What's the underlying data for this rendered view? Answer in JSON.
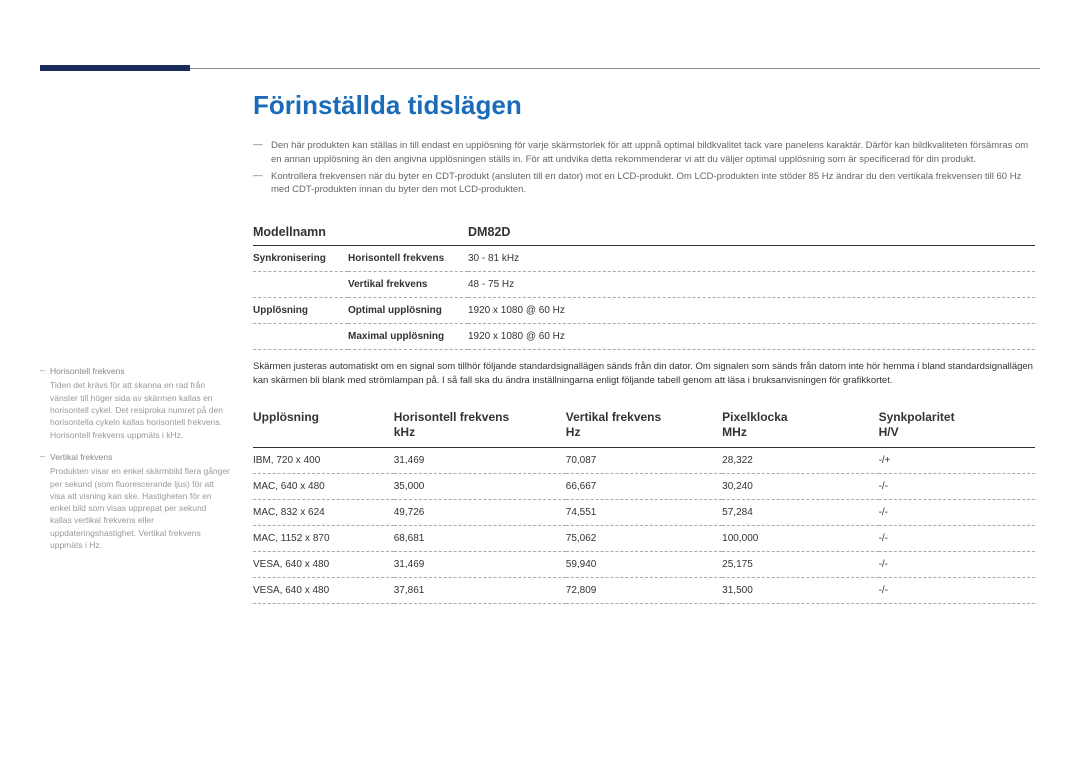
{
  "title": "Förinställda tidslägen",
  "notes": [
    "Den här produkten kan ställas in till endast en upplösning för varje skärmstorlek för att uppnå optimal bildkvalitet tack vare panelens karaktär. Därför kan bildkvaliteten försämras om en annan upplösning än den angivna upplösningen ställs in. För att undvika detta rekommenderar vi att du väljer optimal upplösning som är specificerad för din produkt.",
    "Kontrollera frekvensen när du byter en CDT-produkt (ansluten till en dator) mot en LCD-produkt. Om LCD-produkten inte stöder 85 Hz ändrar du den vertikala frekvensen till 60 Hz med CDT-produkten innan du byter den mot LCD-produkten."
  ],
  "spec": {
    "model_label": "Modellnamn",
    "model_value": "DM82D",
    "rows": [
      {
        "group": "Synkronisering",
        "k": "Horisontell frekvens",
        "v": "30 - 81 kHz"
      },
      {
        "group": "",
        "k": "Vertikal frekvens",
        "v": "48 - 75 Hz"
      },
      {
        "group": "Upplösning",
        "k": "Optimal upplösning",
        "v": "1920 x 1080 @ 60 Hz"
      },
      {
        "group": "",
        "k": "Maximal upplösning",
        "v": "1920 x 1080 @ 60 Hz"
      }
    ]
  },
  "between_text": "Skärmen justeras automatiskt om en signal som tillhör följande standardsignallägen sänds från din dator. Om signalen som sänds från datorn inte hör hemma i bland standardsignallägen kan skärmen bli blank med strömlampan på. I så fall ska du ändra inställningarna enligt följande tabell genom att läsa i bruksanvisningen för grafikkortet.",
  "timing": {
    "headers": {
      "res": {
        "l1": "Upplösning",
        "l2": ""
      },
      "hfreq": {
        "l1": "Horisontell frekvens",
        "l2": "kHz"
      },
      "vfreq": {
        "l1": "Vertikal frekvens",
        "l2": "Hz"
      },
      "pclk": {
        "l1": "Pixelklocka",
        "l2": "MHz"
      },
      "pol": {
        "l1": "Synkpolaritet",
        "l2": "H/V"
      }
    },
    "rows": [
      {
        "res": "IBM, 720 x 400",
        "h": "31,469",
        "v": "70,087",
        "p": "28,322",
        "pol": "-/+"
      },
      {
        "res": "MAC, 640 x 480",
        "h": "35,000",
        "v": "66,667",
        "p": "30,240",
        "pol": "-/-"
      },
      {
        "res": "MAC, 832 x 624",
        "h": "49,726",
        "v": "74,551",
        "p": "57,284",
        "pol": "-/-"
      },
      {
        "res": "MAC, 1152 x 870",
        "h": "68,681",
        "v": "75,062",
        "p": "100,000",
        "pol": "-/-"
      },
      {
        "res": "VESA, 640 x 480",
        "h": "31,469",
        "v": "59,940",
        "p": "25,175",
        "pol": "-/-"
      },
      {
        "res": "VESA, 640 x 480",
        "h": "37,861",
        "v": "72,809",
        "p": "31,500",
        "pol": "-/-"
      }
    ]
  },
  "sidebar": {
    "h": {
      "term": "Horisontell frekvens",
      "def": "Tiden det krävs för att skanna en rad från vänster till höger sida av skärmen kallas en horisontell cykel. Det resiproka numret på den horisontella cykeln kallas horisontell frekvens. Horisontell frekvens uppmäts i kHz."
    },
    "v": {
      "term": "Vertikal frekvens",
      "def": "Produkten visar en enkel skärmbild flera gånger per sekund (som fluorescerande ljus) för att visa att visning kan ske. Hastigheten för en enkel bild som visas upprepat per sekund kallas vertikal frekvens eller uppdateringshastighet. Vertikal frekvens uppmäts i Hz."
    }
  }
}
